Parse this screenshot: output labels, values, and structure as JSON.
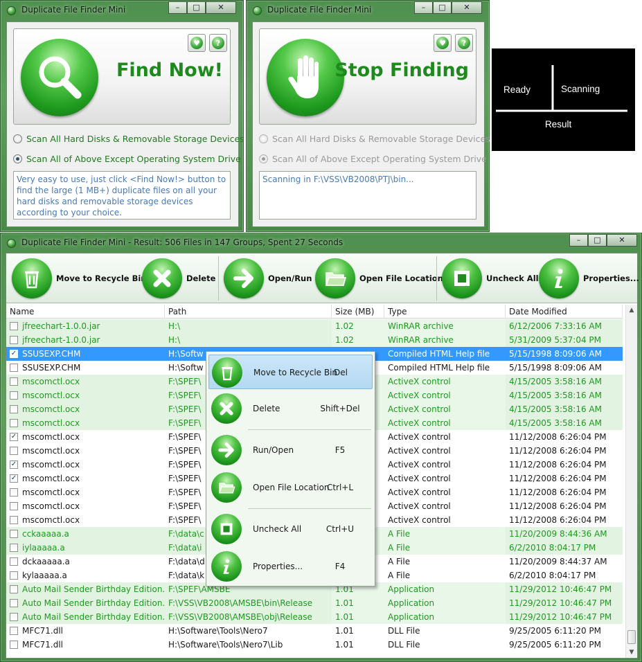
{
  "finder_window": {
    "title": "Duplicate File Finder Mini",
    "find_label": "Find Now!",
    "radio1": "Scan All Hard Disks & Removable Storage Devices",
    "radio2": "Scan All of Above Except Operating System Drive",
    "info": "Very easy to use, just click <Find Now!> button to find the large (1 MB+) duplicate files on all your hard disks and removable storage devices according to your choice."
  },
  "stop_window": {
    "title": "Duplicate File Finder Mini",
    "stop_label": "Stop Finding",
    "radio1": "Scan All Hard Disks & Removable Storage Devices",
    "radio2": "Scan All of Above Except Operating System Drive",
    "status": "Scanning in F:\\VSS\\VB2008\\PTJ\\bin..."
  },
  "state_diagram": {
    "ready": "Ready",
    "scanning": "Scanning",
    "result": "Result"
  },
  "main_window": {
    "title": "Duplicate File Finder Mini - Result: 506 Files in 147 Groups, Spent 27 Seconds",
    "toolbar": {
      "recycle": "Move to Recycle Bin",
      "delete": "Delete",
      "open_run": "Open/Run",
      "open_location": "Open File Location",
      "uncheck_all": "Uncheck All",
      "properties": "Properties..."
    },
    "columns": [
      "Name",
      "Path",
      "Size (MB)",
      "Type",
      "Date Modified"
    ],
    "rows": [
      [
        "jfreechart-1.0.0.jar",
        "H:\\",
        "1.02",
        "WinRAR archive",
        "6/12/2006 7:33:16 AM"
      ],
      [
        "jfreechart-1.0.0.jar",
        "H:\\",
        "1.02",
        "WinRAR archive",
        "5/31/2009 5:37:04 PM"
      ],
      [
        "SSUSEXP.CHM",
        "H:\\Softw",
        "",
        "Compiled HTML Help file",
        "5/15/1998 8:09:06 AM"
      ],
      [
        "SSUSEXP.CHM",
        "H:\\Softw",
        "",
        "Compiled HTML Help file",
        "5/15/1998 8:09:06 AM"
      ],
      [
        "mscomctl.ocx",
        "F:\\SPEF\\",
        "",
        "ActiveX control",
        "4/15/2005 3:58:16 AM"
      ],
      [
        "mscomctl.ocx",
        "F:\\SPEF\\",
        "",
        "ActiveX control",
        "4/15/2005 3:58:16 AM"
      ],
      [
        "mscomctl.ocx",
        "F:\\SPEF\\",
        "",
        "ActiveX control",
        "4/15/2005 3:58:16 AM"
      ],
      [
        "mscomctl.ocx",
        "F:\\SPEF\\",
        "",
        "ActiveX control",
        "4/15/2005 3:58:16 AM"
      ],
      [
        "mscomctl.ocx",
        "F:\\SPEF\\",
        "",
        "ActiveX control",
        "11/12/2008 6:26:04 PM"
      ],
      [
        "mscomctl.ocx",
        "F:\\SPEF\\",
        "",
        "ActiveX control",
        "11/12/2008 6:26:04 PM"
      ],
      [
        "mscomctl.ocx",
        "F:\\SPEF\\",
        "",
        "ActiveX control",
        "11/12/2008 6:26:04 PM"
      ],
      [
        "mscomctl.ocx",
        "F:\\SPEF\\",
        "",
        "ActiveX control",
        "11/12/2008 6:26:04 PM"
      ],
      [
        "mscomctl.ocx",
        "F:\\SPEF\\",
        "",
        "ActiveX control",
        "11/12/2008 6:26:04 PM"
      ],
      [
        "mscomctl.ocx",
        "F:\\SPEF\\",
        "",
        "ActiveX control",
        "11/12/2008 6:26:04 PM"
      ],
      [
        "mscomctl.ocx",
        "F:\\SPEF\\",
        "",
        "ActiveX control",
        "11/12/2008 6:26:04 PM"
      ],
      [
        "cckaaaaa.a",
        "F:\\data\\c",
        "",
        "A File",
        "11/20/2009 8:44:36 AM"
      ],
      [
        "iylaaaaa.a",
        "F:\\data\\i",
        "",
        "A File",
        "6/2/2010 8:04:17 PM"
      ],
      [
        "dckaaaaa.a",
        "F:\\data\\d",
        "",
        "A File",
        "11/20/2009 8:44:37 AM"
      ],
      [
        "kylaaaaa.a",
        "F:\\data\\k",
        "",
        "A File",
        "6/2/2010 8:04:17 PM"
      ],
      [
        "Auto Mail Sender Birthday Edition...",
        "F:\\SPEF\\AMSBE",
        "1.01",
        "Application",
        "11/29/2012 10:46:47 PM"
      ],
      [
        "Auto Mail Sender Birthday Edition...",
        "F:\\VSS\\VB2008\\AMSBE\\bin\\Release",
        "1.01",
        "Application",
        "11/29/2012 10:46:47 PM"
      ],
      [
        "Auto Mail Sender Birthday Edition...",
        "F:\\VSS\\VB2008\\AMSBE\\obj\\Release",
        "1.01",
        "Application",
        "11/29/2012 10:46:47 PM"
      ],
      [
        "MFC71.dll",
        "H:\\Software\\Tools\\Nero7",
        "1.01",
        "DLL File",
        "9/25/2005 6:11:20 PM"
      ],
      [
        "MFC71.dll",
        "H:\\Software\\Tools\\Nero7\\Lib",
        "1.01",
        "DLL File",
        "9/25/2005 6:11:20 PM"
      ]
    ],
    "context_menu": {
      "recycle": "Move to Recycle Bin",
      "recycle_key": "Del",
      "delete": "Delete",
      "delete_key": "Shift+Del",
      "run_open": "Run/Open",
      "run_open_key": "F5",
      "open_location": "Open File Location",
      "open_location_key": "Ctrl+L",
      "uncheck_all": "Uncheck All",
      "uncheck_all_key": "Ctrl+U",
      "properties": "Properties...",
      "properties_key": "F4"
    }
  }
}
